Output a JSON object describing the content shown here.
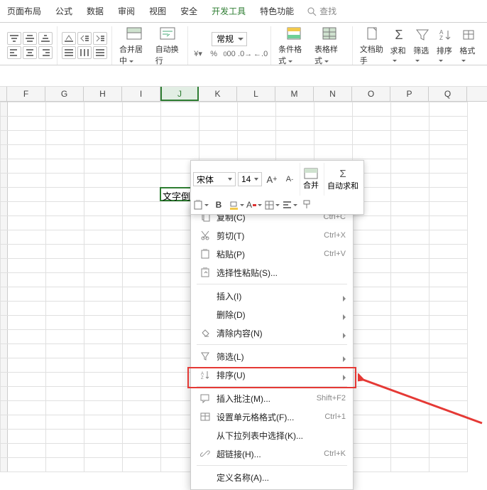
{
  "ribbon": {
    "tabs": [
      "页面布局",
      "公式",
      "数据",
      "审阅",
      "视图",
      "安全",
      "开发工具",
      "特色功能"
    ],
    "active_tab": "开发工具",
    "search_label": "查找",
    "merge_label": "合并居中",
    "wrap_label": "自动换行",
    "number_format": "常规",
    "cond_fmt": "条件格式",
    "table_style": "表格样式",
    "doc_helper": "文档助手",
    "sum": "求和",
    "filter": "筛选",
    "sort": "排序",
    "format": "格式"
  },
  "columns": [
    "F",
    "G",
    "H",
    "I",
    "J",
    "K",
    "L",
    "M",
    "N",
    "O",
    "P",
    "Q"
  ],
  "active_col": "J",
  "cell_text": "文字倒下来",
  "minibar": {
    "font": "宋体",
    "size": "14",
    "merge": "合并",
    "autosum": "自动求和"
  },
  "menu": [
    {
      "icon": "copy",
      "label": "复制(C)",
      "shortcut": "Ctrl+C"
    },
    {
      "icon": "cut",
      "label": "剪切(T)",
      "shortcut": "Ctrl+X"
    },
    {
      "icon": "paste",
      "label": "粘贴(P)",
      "shortcut": "Ctrl+V"
    },
    {
      "icon": "paste-special",
      "label": "选择性粘贴(S)...",
      "shortcut": ""
    },
    {
      "sep": true
    },
    {
      "icon": "insert",
      "label": "插入(I)",
      "sub": true
    },
    {
      "icon": "delete",
      "label": "删除(D)",
      "sub": true
    },
    {
      "icon": "clear",
      "label": "清除内容(N)",
      "sub": true
    },
    {
      "sep": true
    },
    {
      "icon": "filter",
      "label": "筛选(L)",
      "sub": true
    },
    {
      "icon": "sort",
      "label": "排序(U)",
      "sub": true
    },
    {
      "sep": true
    },
    {
      "icon": "comment",
      "label": "插入批注(M)...",
      "shortcut": "Shift+F2"
    },
    {
      "icon": "format-cells",
      "label": "设置单元格格式(F)...",
      "shortcut": "Ctrl+1",
      "highlight": true
    },
    {
      "icon": "dropdown",
      "label": "从下拉列表中选择(K)...",
      "shortcut": ""
    },
    {
      "icon": "hyperlink",
      "label": "超链接(H)...",
      "shortcut": "Ctrl+K"
    },
    {
      "sep": true
    },
    {
      "icon": "name",
      "label": "定义名称(A)...",
      "shortcut": ""
    }
  ]
}
